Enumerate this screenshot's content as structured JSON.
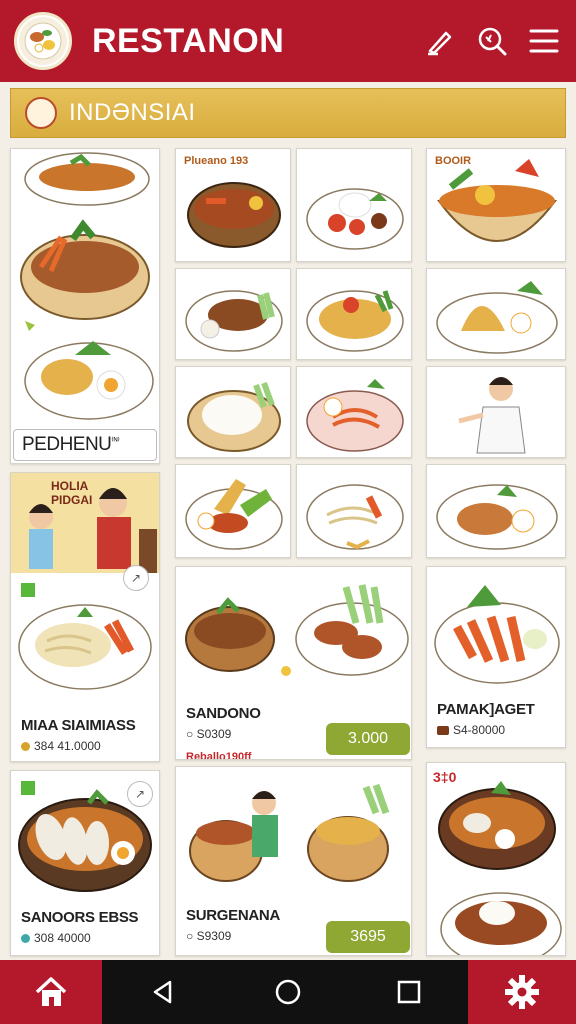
{
  "header": {
    "brand": "RESTANON",
    "logo": "food-plate-logo",
    "icons": [
      "pen-icon",
      "search-icon",
      "menu-icon"
    ]
  },
  "category": {
    "title": "INDƏNSIAI",
    "icon": "dish-icon"
  },
  "left_panel": {
    "label": "PEDHENU",
    "label_suffix": "⁽ᴺ⁾"
  },
  "banner": {
    "text_line1": "HOLIA",
    "text_line2": "PIDGAI"
  },
  "col2_tag": "Plueano 193",
  "col4_tag": "BOOIR",
  "items": [
    {
      "title": "MIAA SIAIMIASS",
      "price": "384 41.0000"
    },
    {
      "title": "SANDONO",
      "price": "S0309",
      "tag": "Reballo190ff",
      "button": "3.000"
    },
    {
      "title": "PAMAK]AGET",
      "price": "S4-80000"
    },
    {
      "title": "SANOORS EBSS",
      "price": "308 40000"
    },
    {
      "title": "SURGENANA",
      "price": "S9309",
      "button": "3695"
    }
  ],
  "corner_tag": "3‡0",
  "nav": {
    "home": "home-icon",
    "back": "back-icon",
    "home_circle": "circle-icon",
    "recents": "square-icon",
    "settings": "gear-icon"
  },
  "colors": {
    "primary": "#b3182b",
    "gold": "#d9ad3e",
    "green": "#8fa834"
  }
}
